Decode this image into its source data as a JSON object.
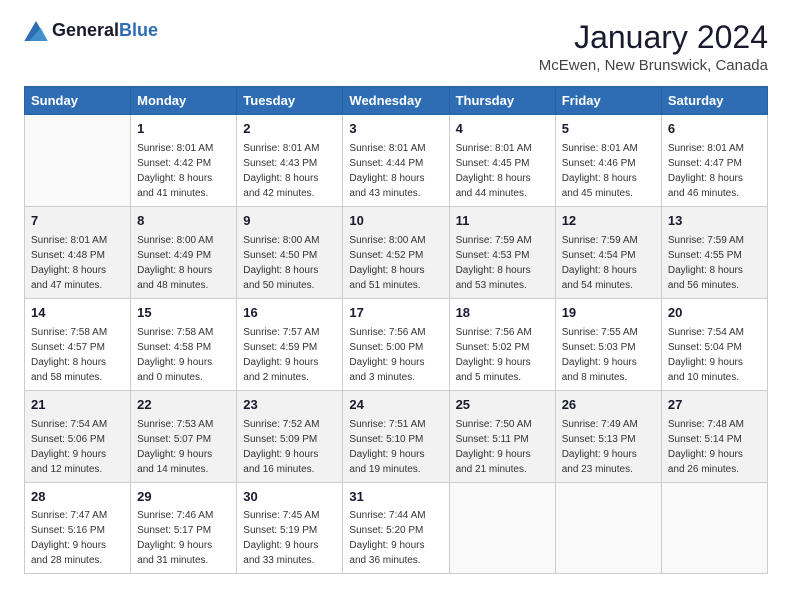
{
  "logo": {
    "text_general": "General",
    "text_blue": "Blue"
  },
  "header": {
    "title": "January 2024",
    "subtitle": "McEwen, New Brunswick, Canada"
  },
  "days_of_week": [
    "Sunday",
    "Monday",
    "Tuesday",
    "Wednesday",
    "Thursday",
    "Friday",
    "Saturday"
  ],
  "weeks": [
    [
      {
        "day": "",
        "sunrise": "",
        "sunset": "",
        "daylight": ""
      },
      {
        "day": "1",
        "sunrise": "Sunrise: 8:01 AM",
        "sunset": "Sunset: 4:42 PM",
        "daylight": "Daylight: 8 hours and 41 minutes."
      },
      {
        "day": "2",
        "sunrise": "Sunrise: 8:01 AM",
        "sunset": "Sunset: 4:43 PM",
        "daylight": "Daylight: 8 hours and 42 minutes."
      },
      {
        "day": "3",
        "sunrise": "Sunrise: 8:01 AM",
        "sunset": "Sunset: 4:44 PM",
        "daylight": "Daylight: 8 hours and 43 minutes."
      },
      {
        "day": "4",
        "sunrise": "Sunrise: 8:01 AM",
        "sunset": "Sunset: 4:45 PM",
        "daylight": "Daylight: 8 hours and 44 minutes."
      },
      {
        "day": "5",
        "sunrise": "Sunrise: 8:01 AM",
        "sunset": "Sunset: 4:46 PM",
        "daylight": "Daylight: 8 hours and 45 minutes."
      },
      {
        "day": "6",
        "sunrise": "Sunrise: 8:01 AM",
        "sunset": "Sunset: 4:47 PM",
        "daylight": "Daylight: 8 hours and 46 minutes."
      }
    ],
    [
      {
        "day": "7",
        "sunrise": "Sunrise: 8:01 AM",
        "sunset": "Sunset: 4:48 PM",
        "daylight": "Daylight: 8 hours and 47 minutes."
      },
      {
        "day": "8",
        "sunrise": "Sunrise: 8:00 AM",
        "sunset": "Sunset: 4:49 PM",
        "daylight": "Daylight: 8 hours and 48 minutes."
      },
      {
        "day": "9",
        "sunrise": "Sunrise: 8:00 AM",
        "sunset": "Sunset: 4:50 PM",
        "daylight": "Daylight: 8 hours and 50 minutes."
      },
      {
        "day": "10",
        "sunrise": "Sunrise: 8:00 AM",
        "sunset": "Sunset: 4:52 PM",
        "daylight": "Daylight: 8 hours and 51 minutes."
      },
      {
        "day": "11",
        "sunrise": "Sunrise: 7:59 AM",
        "sunset": "Sunset: 4:53 PM",
        "daylight": "Daylight: 8 hours and 53 minutes."
      },
      {
        "day": "12",
        "sunrise": "Sunrise: 7:59 AM",
        "sunset": "Sunset: 4:54 PM",
        "daylight": "Daylight: 8 hours and 54 minutes."
      },
      {
        "day": "13",
        "sunrise": "Sunrise: 7:59 AM",
        "sunset": "Sunset: 4:55 PM",
        "daylight": "Daylight: 8 hours and 56 minutes."
      }
    ],
    [
      {
        "day": "14",
        "sunrise": "Sunrise: 7:58 AM",
        "sunset": "Sunset: 4:57 PM",
        "daylight": "Daylight: 8 hours and 58 minutes."
      },
      {
        "day": "15",
        "sunrise": "Sunrise: 7:58 AM",
        "sunset": "Sunset: 4:58 PM",
        "daylight": "Daylight: 9 hours and 0 minutes."
      },
      {
        "day": "16",
        "sunrise": "Sunrise: 7:57 AM",
        "sunset": "Sunset: 4:59 PM",
        "daylight": "Daylight: 9 hours and 2 minutes."
      },
      {
        "day": "17",
        "sunrise": "Sunrise: 7:56 AM",
        "sunset": "Sunset: 5:00 PM",
        "daylight": "Daylight: 9 hours and 3 minutes."
      },
      {
        "day": "18",
        "sunrise": "Sunrise: 7:56 AM",
        "sunset": "Sunset: 5:02 PM",
        "daylight": "Daylight: 9 hours and 5 minutes."
      },
      {
        "day": "19",
        "sunrise": "Sunrise: 7:55 AM",
        "sunset": "Sunset: 5:03 PM",
        "daylight": "Daylight: 9 hours and 8 minutes."
      },
      {
        "day": "20",
        "sunrise": "Sunrise: 7:54 AM",
        "sunset": "Sunset: 5:04 PM",
        "daylight": "Daylight: 9 hours and 10 minutes."
      }
    ],
    [
      {
        "day": "21",
        "sunrise": "Sunrise: 7:54 AM",
        "sunset": "Sunset: 5:06 PM",
        "daylight": "Daylight: 9 hours and 12 minutes."
      },
      {
        "day": "22",
        "sunrise": "Sunrise: 7:53 AM",
        "sunset": "Sunset: 5:07 PM",
        "daylight": "Daylight: 9 hours and 14 minutes."
      },
      {
        "day": "23",
        "sunrise": "Sunrise: 7:52 AM",
        "sunset": "Sunset: 5:09 PM",
        "daylight": "Daylight: 9 hours and 16 minutes."
      },
      {
        "day": "24",
        "sunrise": "Sunrise: 7:51 AM",
        "sunset": "Sunset: 5:10 PM",
        "daylight": "Daylight: 9 hours and 19 minutes."
      },
      {
        "day": "25",
        "sunrise": "Sunrise: 7:50 AM",
        "sunset": "Sunset: 5:11 PM",
        "daylight": "Daylight: 9 hours and 21 minutes."
      },
      {
        "day": "26",
        "sunrise": "Sunrise: 7:49 AM",
        "sunset": "Sunset: 5:13 PM",
        "daylight": "Daylight: 9 hours and 23 minutes."
      },
      {
        "day": "27",
        "sunrise": "Sunrise: 7:48 AM",
        "sunset": "Sunset: 5:14 PM",
        "daylight": "Daylight: 9 hours and 26 minutes."
      }
    ],
    [
      {
        "day": "28",
        "sunrise": "Sunrise: 7:47 AM",
        "sunset": "Sunset: 5:16 PM",
        "daylight": "Daylight: 9 hours and 28 minutes."
      },
      {
        "day": "29",
        "sunrise": "Sunrise: 7:46 AM",
        "sunset": "Sunset: 5:17 PM",
        "daylight": "Daylight: 9 hours and 31 minutes."
      },
      {
        "day": "30",
        "sunrise": "Sunrise: 7:45 AM",
        "sunset": "Sunset: 5:19 PM",
        "daylight": "Daylight: 9 hours and 33 minutes."
      },
      {
        "day": "31",
        "sunrise": "Sunrise: 7:44 AM",
        "sunset": "Sunset: 5:20 PM",
        "daylight": "Daylight: 9 hours and 36 minutes."
      },
      {
        "day": "",
        "sunrise": "",
        "sunset": "",
        "daylight": ""
      },
      {
        "day": "",
        "sunrise": "",
        "sunset": "",
        "daylight": ""
      },
      {
        "day": "",
        "sunrise": "",
        "sunset": "",
        "daylight": ""
      }
    ]
  ]
}
